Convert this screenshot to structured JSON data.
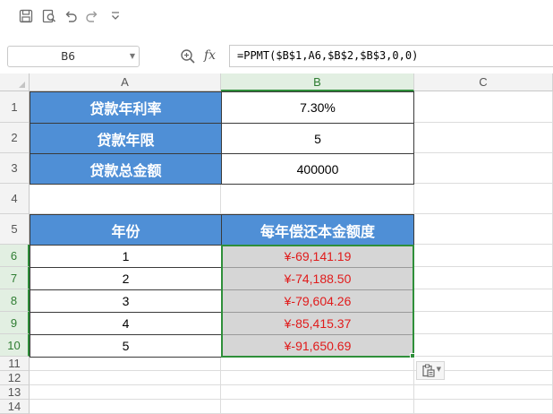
{
  "toolbar": {
    "icons": [
      "save-icon",
      "print-preview-icon",
      "undo-icon",
      "redo-icon",
      "customize-chevron-icon"
    ]
  },
  "formula_bar": {
    "name_box": "B6",
    "fx_label": "fx",
    "formula": "=PPMT($B$1,A6,$B$2,$B$3,0,0)"
  },
  "columns": [
    "A",
    "B",
    "C"
  ],
  "rows": [
    "1",
    "2",
    "3",
    "4",
    "5",
    "6",
    "7",
    "8",
    "9",
    "10",
    "11",
    "12",
    "13",
    "14"
  ],
  "sheet": {
    "r1": {
      "label": "贷款年利率",
      "value": "7.30%"
    },
    "r2": {
      "label": "贷款年限",
      "value": "5"
    },
    "r3": {
      "label": "贷款总金额",
      "value": "400000"
    },
    "table_header": {
      "col_a": "年份",
      "col_b": "每年偿还本金额度"
    },
    "table_rows": [
      {
        "year": "1",
        "amount": "¥-69,141.19"
      },
      {
        "year": "2",
        "amount": "¥-74,188.50"
      },
      {
        "year": "3",
        "amount": "¥-79,604.26"
      },
      {
        "year": "4",
        "amount": "¥-85,415.37"
      },
      {
        "year": "5",
        "amount": "¥-91,650.69"
      }
    ]
  },
  "colors": {
    "header_blue": "#4f8fd6",
    "selection_green": "#2f8f3a",
    "negative_red": "#e01b1b",
    "selected_fill": "#d6d6d6"
  },
  "paste_options_icon": "paste-options-icon"
}
